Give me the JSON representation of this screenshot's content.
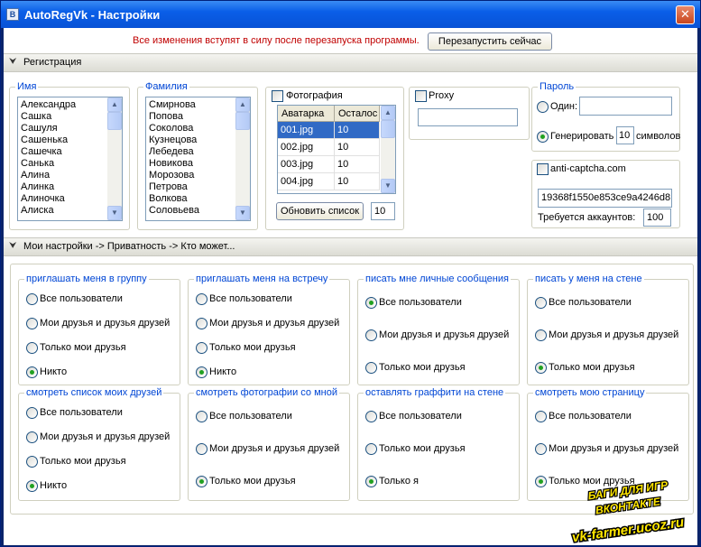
{
  "window": {
    "title": "AutoRegVk - Настройки",
    "icon": "B",
    "close": "✕"
  },
  "notice": {
    "text": "Все изменения вступят в силу после перезапуска программы.",
    "restart_label": "Перезапустить сейчас"
  },
  "registration": {
    "section_label": "Регистрация",
    "names": {
      "title": "Имя",
      "items": [
        "Александра",
        "Сашка",
        "Сашуля",
        "Сашенька",
        "Сашечка",
        "Санька",
        "Алина",
        "Алинка",
        "Алиночка",
        "Алиска"
      ]
    },
    "surnames": {
      "title": "Фамилия",
      "items": [
        "Смирнова",
        "Попова",
        "Соколова",
        "Кузнецова",
        "Лебедева",
        "Новикова",
        "Морозова",
        "Петрова",
        "Волкова",
        "Соловьева"
      ]
    },
    "photo": {
      "label": "Фотография",
      "checked": false,
      "columns": [
        "Аватарка",
        "Осталос"
      ],
      "rows": [
        [
          "001.jpg",
          "10"
        ],
        [
          "002.jpg",
          "10"
        ],
        [
          "003.jpg",
          "10"
        ],
        [
          "004.jpg",
          "10"
        ]
      ],
      "refresh_label": "Обновить список",
      "count": "10"
    },
    "proxy": {
      "label": "Proxy",
      "checked": false,
      "value": ""
    },
    "password": {
      "title": "Пароль",
      "one_label": "Один:",
      "one_value": "",
      "gen_label": "Генерировать",
      "gen_count": "10",
      "gen_suffix": "символов",
      "selected": "generate"
    },
    "anticaptcha": {
      "label": "anti-captcha.com",
      "checked": false,
      "key": "19368f1550e853ce9a4246d8",
      "accounts_label": "Требуется аккаунтов:",
      "accounts": "100"
    }
  },
  "settings": {
    "section_label": "Мои настройки  ->  Приватность  ->  Кто может...",
    "groups": [
      {
        "title": "приглашать меня в группу",
        "options": [
          "Все пользователи",
          "Мои друзья и друзья друзей",
          "Только мои друзья",
          "Никто"
        ],
        "selected": 3
      },
      {
        "title": "приглашать меня на встречу",
        "options": [
          "Все пользователи",
          "Мои друзья и друзья друзей",
          "Только мои друзья",
          "Никто"
        ],
        "selected": 3
      },
      {
        "title": "писать мне личные сообщения",
        "options": [
          "Все пользователи",
          "Мои друзья и друзья друзей",
          "Только мои друзья"
        ],
        "selected": 0
      },
      {
        "title": "писать у меня на стене",
        "options": [
          "Все пользователи",
          "Мои друзья и друзья друзей",
          "Только мои друзья"
        ],
        "selected": 2
      },
      {
        "title": "смотреть список моих друзей",
        "options": [
          "Все пользователи",
          "Мои друзья и друзья друзей",
          "Только мои друзья",
          "Никто"
        ],
        "selected": 3
      },
      {
        "title": "смотреть фотографии со мной",
        "options": [
          "Все пользователи",
          "Мои друзья и друзья друзей",
          "Только мои друзья"
        ],
        "selected": 2
      },
      {
        "title": "оставлять граффити на стене",
        "options": [
          "Все пользователи",
          "Только мои друзья",
          "Только я"
        ],
        "selected": 2
      },
      {
        "title": "смотреть мою страницу",
        "options": [
          "Все пользователи",
          "Мои друзья и друзья друзей",
          "Только мои друзья"
        ],
        "selected": 2
      }
    ]
  },
  "watermark": {
    "line1": "БАГИ ДЛЯ ИГР",
    "line2": "ВКОНТАКТЕ",
    "line3": "vk-farmer.ucoz.ru"
  }
}
